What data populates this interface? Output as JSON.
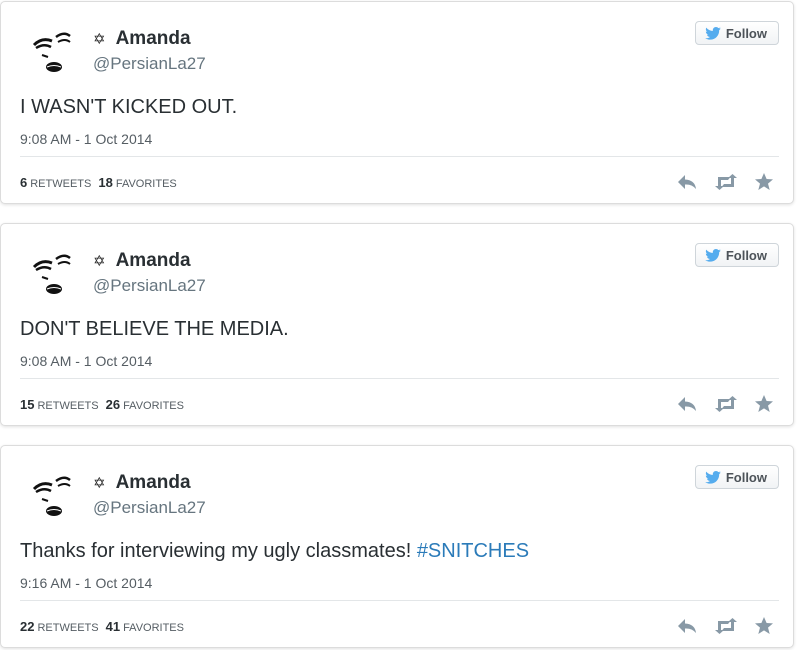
{
  "tweets": [
    {
      "display_name": "Amanda",
      "name_symbol": "✡",
      "handle": "@PersianLa27",
      "follow_label": "Follow",
      "text": "I WASN'T KICKED OUT.",
      "hashtag": "",
      "timestamp": "9:08 AM - 1 Oct 2014",
      "retweets": "6",
      "retweets_label": "RETWEETS",
      "favorites": "18",
      "favorites_label": "FAVORITES"
    },
    {
      "display_name": "Amanda",
      "name_symbol": "✡",
      "handle": "@PersianLa27",
      "follow_label": "Follow",
      "text": "DON'T BELIEVE THE MEDIA.",
      "hashtag": "",
      "timestamp": "9:08 AM - 1 Oct 2014",
      "retweets": "15",
      "retweets_label": "RETWEETS",
      "favorites": "26",
      "favorites_label": "FAVORITES"
    },
    {
      "display_name": "Amanda",
      "name_symbol": "✡",
      "handle": "@PersianLa27",
      "follow_label": "Follow",
      "text": "Thanks for interviewing my ugly classmates! ",
      "hashtag": "#SNITCHES",
      "timestamp": "9:16 AM - 1 Oct 2014",
      "retweets": "22",
      "retweets_label": "RETWEETS",
      "favorites": "41",
      "favorites_label": "FAVORITES"
    }
  ],
  "icons": {
    "follow": "twitter-bird-icon",
    "reply": "reply-icon",
    "retweet": "retweet-icon",
    "favorite": "star-icon"
  },
  "colors": {
    "hashtag": "#2b7bb9",
    "twitter_blue": "#55acee",
    "action_gray": "#8899a6"
  }
}
